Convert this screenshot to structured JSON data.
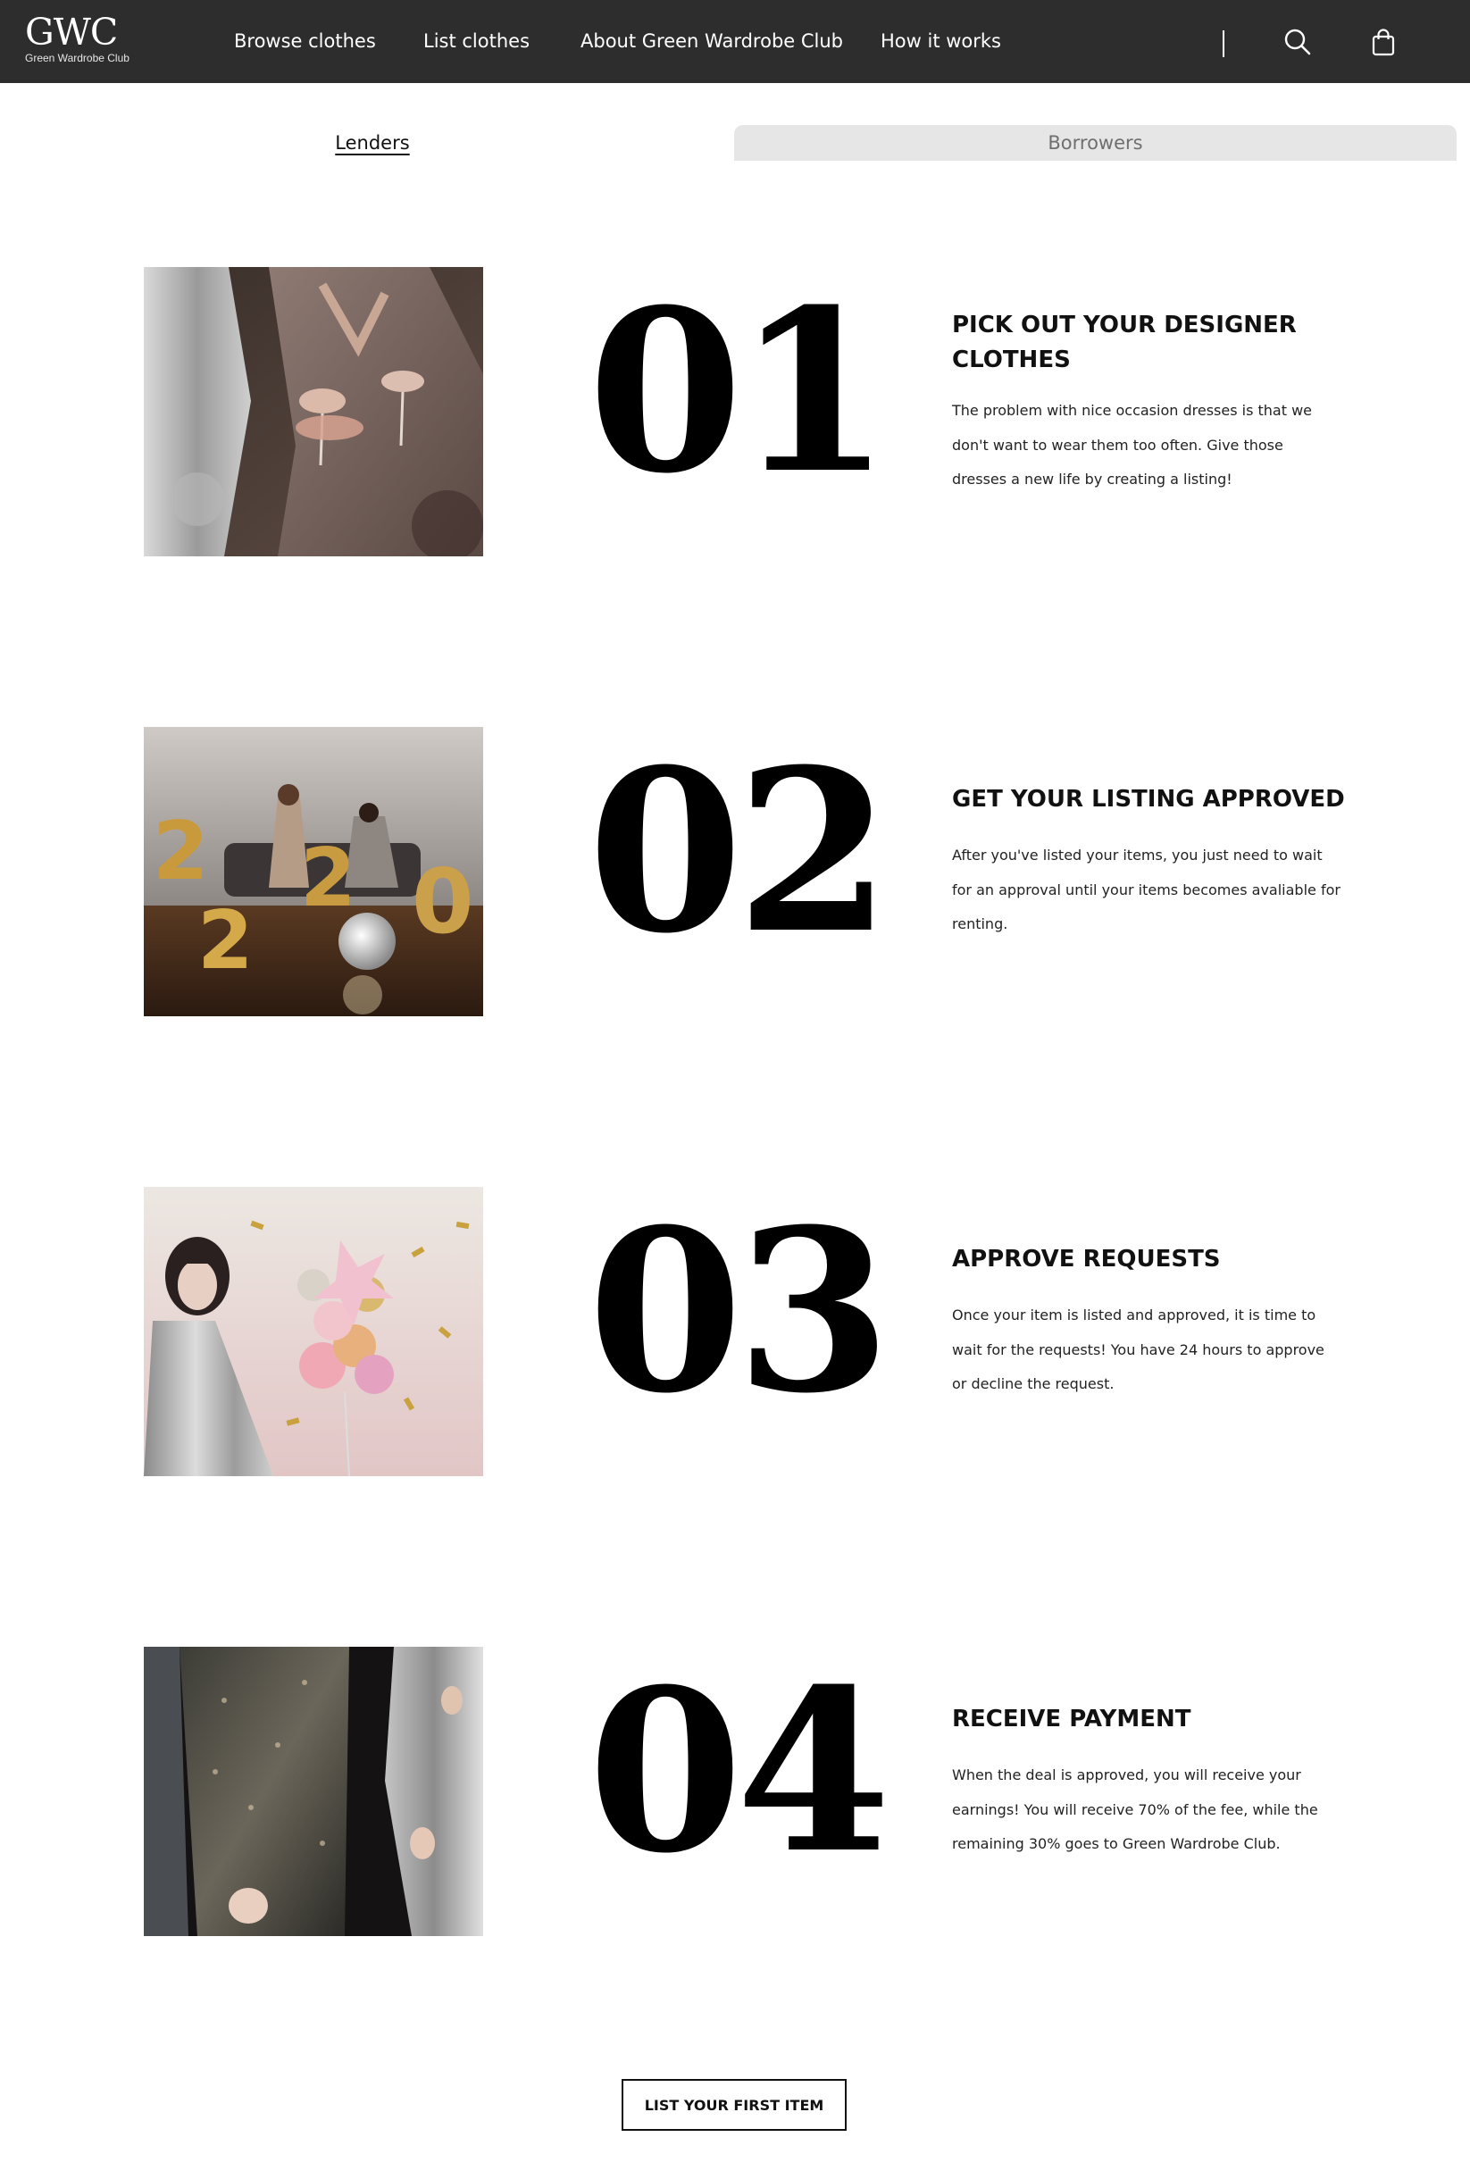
{
  "header": {
    "logo_mark": "GWC",
    "logo_sub": "Green Wardrobe Club",
    "nav": [
      {
        "label": "Browse clothes"
      },
      {
        "label": "List clothes"
      },
      {
        "label": "About Green Wardrobe Club"
      },
      {
        "label": "How it works"
      }
    ],
    "icons": {
      "search": "search-icon",
      "cart": "shopping-bag-icon"
    }
  },
  "tabs": [
    {
      "label": "Lenders",
      "active": true
    },
    {
      "label": "Borrowers",
      "active": false
    }
  ],
  "steps": [
    {
      "number": "01",
      "title": "PICK OUT YOUR DESIGNER CLOTHES",
      "text": "The problem with nice occasion dresses is that we don't want to wear them too often. Give those dresses a new life by creating a listing!"
    },
    {
      "number": "02",
      "title": "GET YOUR LISTING APPROVED",
      "text": "After you've listed your items, you just need to wait for an approval until your items becomes avaliable for renting."
    },
    {
      "number": "03",
      "title": "APPROVE REQUESTS",
      "text": "Once your item is listed and approved, it is time to wait for the requests! You have 24 hours to approve or decline the request."
    },
    {
      "number": "04",
      "title": "RECEIVE PAYMENT",
      "text": "When the deal is approved, you will receive your earnings! You will receive 70% of the fee, while the remaining 30% goes to Green Wardrobe Club."
    }
  ],
  "cta": {
    "label": "LIST YOUR FIRST ITEM"
  },
  "colors": {
    "nav_bg": "#2d2d2d",
    "tab_inactive_bg": "#e6e6e6",
    "text": "#111111"
  }
}
